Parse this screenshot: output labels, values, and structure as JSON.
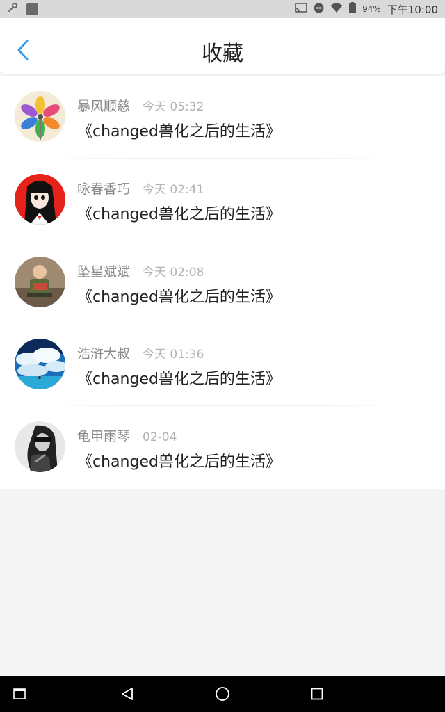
{
  "status_bar": {
    "battery": "94%",
    "time": "下午10:00"
  },
  "header": {
    "title": "收藏"
  },
  "items": [
    {
      "name": "暴风顺慈",
      "time": "今天 05:32",
      "title": "《changed兽化之后的生活》"
    },
    {
      "name": "咏春香巧",
      "time": "今天 02:41",
      "title": "《changed兽化之后的生活》"
    },
    {
      "name": "坠星斌斌",
      "time": "今天 02:08",
      "title": "《changed兽化之后的生活》"
    },
    {
      "name": "浩浒大叔",
      "time": "今天 01:36",
      "title": "《changed兽化之后的生活》"
    },
    {
      "name": "龟甲雨琴",
      "time": "02-04",
      "title": "《changed兽化之后的生活》"
    }
  ],
  "colors": {
    "accent": "#2b9cf2",
    "name_text": "#8a8a8a",
    "time_text": "#b3b3b3",
    "title_text": "#222222"
  },
  "icons": {
    "back": "chevron-left-icon",
    "nav": [
      "recents-window-icon",
      "back-triangle-icon",
      "home-circle-icon",
      "overview-square-icon"
    ]
  }
}
